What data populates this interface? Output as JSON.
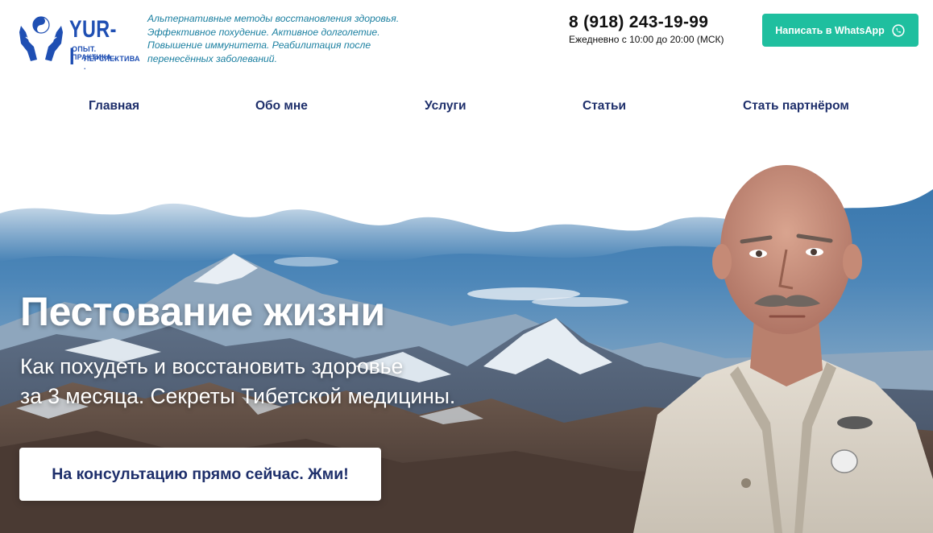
{
  "logo": {
    "word": "YUR-I",
    "sub1": "ОПЫТ. ПРАКТИКА .",
    "sub2": "ПЕРСПЕКТИВА ."
  },
  "tagline": [
    "Альтернативные методы восстановления здоровья.",
    "Эффективное похудение. Активное долголетие.",
    "Повышение иммунитета. Реабилитация после",
    "перенесённых заболеваний."
  ],
  "contact": {
    "phone": "8 (918) 243-19-99",
    "hours": "Ежедневно с 10:00 до 20:00 (МСК)"
  },
  "whatsapp_button": {
    "label": "Написать в WhatsApp",
    "icon": "whatsapp-icon"
  },
  "nav": [
    {
      "label": "Главная"
    },
    {
      "label": "Обо мне"
    },
    {
      "label": "Услуги"
    },
    {
      "label": "Статьи"
    },
    {
      "label": "Стать партнёром"
    }
  ],
  "hero": {
    "title": "Пестование жизни",
    "subtitle_line1": "Как похудеть и восстановить здоровье",
    "subtitle_line2": "за 3 месяца. Секреты Тибетской медицины.",
    "cta_label": "На консультацию прямо сейчас. Жми!"
  },
  "colors": {
    "brand_blue": "#1f4fb3",
    "nav_text": "#1e2f6b",
    "tagline": "#1a7fa0",
    "whatsapp_green": "#1fbf9f"
  }
}
